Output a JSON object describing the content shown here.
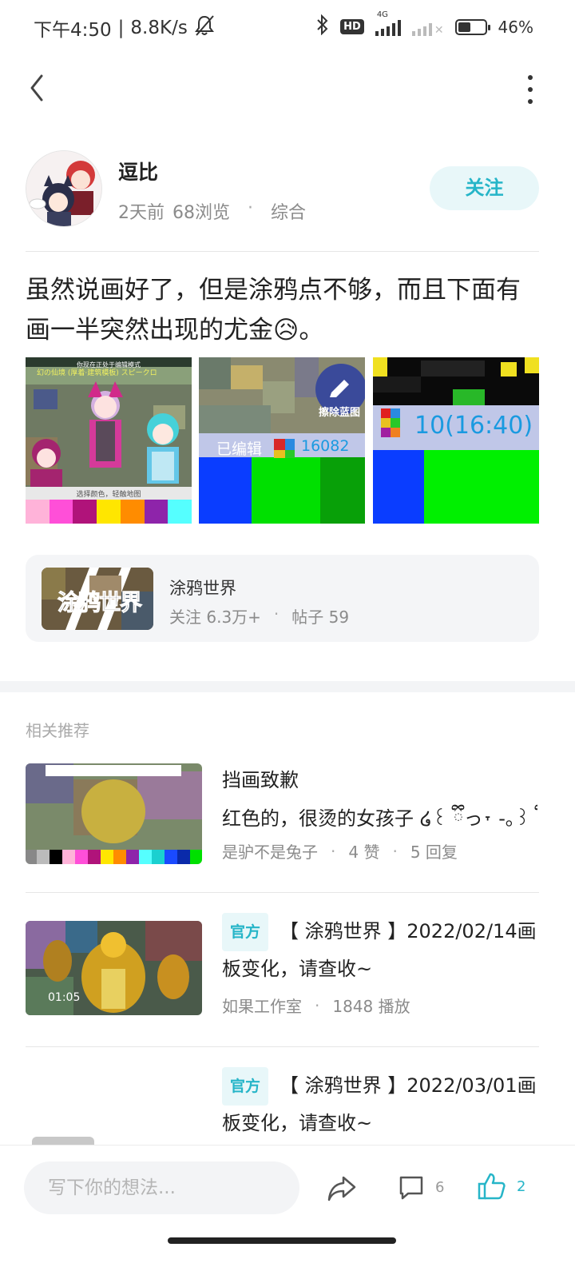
{
  "status_bar": {
    "time": "下午4:50",
    "speed": "8.8K/s",
    "network_label": "4G",
    "hd_label": "HD",
    "battery": "46%",
    "battery_level": 0.46
  },
  "post": {
    "author": "逗比",
    "time_ago": "2天前",
    "views": "68浏览",
    "category": "综合",
    "follow_label": "关注",
    "text": "虽然说画好了，但是涂鸦点不够，而且下面有画一半突然出现的尤金😥。",
    "image1": {
      "header_line1": "幻の仙境 (厚着·建筑模板) スピークロ",
      "header_line2": "你现在正处于编辑模式",
      "footer": "选择颜色，轻触地图",
      "palette": [
        "#ffb3d9",
        "#ff4fd8",
        "#b0137a",
        "#ffe600",
        "#ff8c00",
        "#8e24aa",
        "#55ffff"
      ]
    },
    "image2": {
      "edited_label": "已编辑",
      "pixel_count": "16082",
      "eraser_label": "擦除蓝图"
    },
    "image3": {
      "count_label": "10(16:40)"
    }
  },
  "community": {
    "name": "涂鸦世界",
    "logo_text": "涂鸦世界",
    "followers": "关注 6.3万+",
    "posts": "帖子 59"
  },
  "recommend": {
    "section_title": "相关推荐",
    "items": [
      {
        "title": "挡画致歉",
        "body": "红色的，很烫的女孩子 ໒꒰ ྀིっ˕ -｡꒱ ྀི১ ...",
        "author": "是驴不是兔子",
        "likes": "4 赞",
        "replies": "5 回复"
      },
      {
        "badge": "官方",
        "title": "【 涂鸦世界 】2022/02/14画板变化，请查收~",
        "author": "如果工作室",
        "plays": "1848 播放",
        "duration": "01:05"
      },
      {
        "badge": "官方",
        "title": "【 涂鸦世界 】2022/03/01画板变化，请查收~"
      }
    ]
  },
  "bottom_bar": {
    "comment_placeholder": "写下你的想法...",
    "comment_count": "6",
    "like_count": "2"
  },
  "colors": {
    "accent": "#26b5c8",
    "accent_bg": "#e8f7f9",
    "muted_text": "#8b8b8b"
  }
}
